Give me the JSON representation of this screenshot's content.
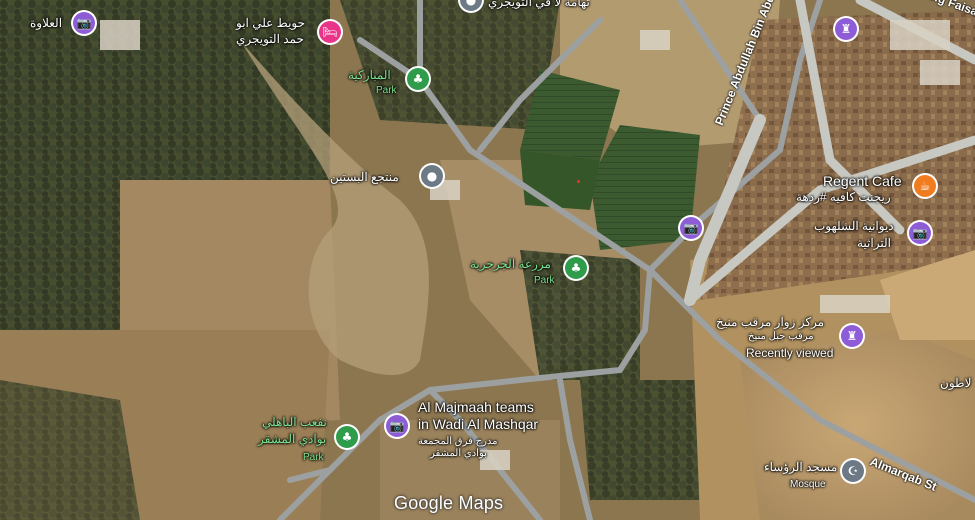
{
  "map": {
    "watermark": "Google Maps",
    "colors": {
      "park": "#2e9c4a",
      "landmark": "#8e5cd6",
      "generic": "#6d7a86",
      "hotel": "#e8358a",
      "cafe": "#f07c1f"
    },
    "places": {
      "al_alawah": {
        "name": "العلاوة",
        "icon": "camera-icon"
      },
      "huwait": {
        "line1": "حويط علي ابو",
        "line2": "حمد التويجري",
        "icon": "bed-icon"
      },
      "mubarakiya": {
        "name": "المباركية",
        "type": "Park",
        "icon": "tree-icon"
      },
      "bustain": {
        "name": "منتجع البستين",
        "icon": "pin-icon"
      },
      "jarjariya": {
        "name": "مزرعة الجرجرية",
        "type": "Park",
        "icon": "tree-icon"
      },
      "bahli": {
        "line1": "نفعب الباهلي",
        "line2": "بوادي المشقر",
        "type": "Park",
        "icon": "tree-icon"
      },
      "majmaah": {
        "line1": "Al Majmaah teams",
        "line2": "in Wadi Al Mashqar",
        "sub1": "مدرج فرق المجمعة",
        "sub2": "بوادي المشقر",
        "icon": "camera-icon"
      },
      "regent": {
        "name": "Regent Cafe",
        "sub": "ريجنت كافيه #ردهة",
        "icon": "coffee-icon"
      },
      "diwaniya": {
        "line1": "ديوانية الشلهوب",
        "line2": "التراثية",
        "icon": "camera-icon"
      },
      "marqab": {
        "line1": "مركز زوار مرقب منيخ",
        "line2": "مرقب جبل منيخ",
        "sub": "Recently viewed",
        "icon": "tower-icon"
      },
      "masjid": {
        "name": "مسجد الرؤساء",
        "type": "Mosque",
        "icon": "mosque-icon"
      },
      "top_partial": {
        "name": "تهامة لا في التويجري"
      },
      "right_partial": {
        "name": "لاطون"
      }
    },
    "roads": {
      "prince": "Prince Abdullah Bin Abdulrahman St",
      "faisal": "King Faisal St",
      "almarqab": "Almarqab St"
    }
  }
}
